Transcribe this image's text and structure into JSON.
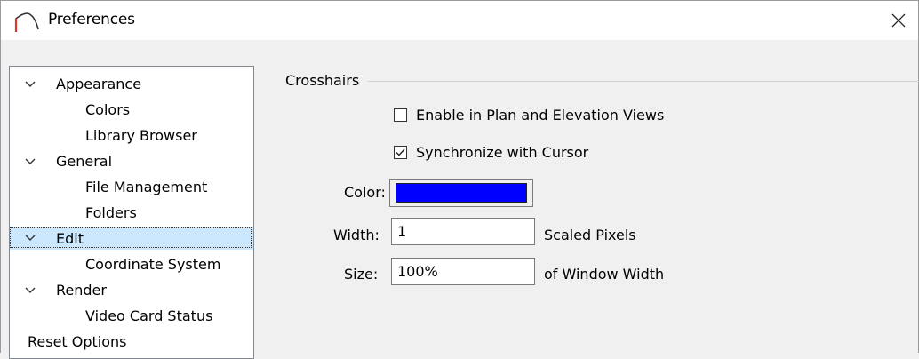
{
  "window": {
    "title": "Preferences"
  },
  "tree": {
    "items": [
      {
        "label": "Appearance",
        "expandable": true
      },
      {
        "label": "Colors",
        "expandable": false
      },
      {
        "label": "Library Browser",
        "expandable": false
      },
      {
        "label": "General",
        "expandable": true
      },
      {
        "label": "File Management",
        "expandable": false
      },
      {
        "label": "Folders",
        "expandable": false
      },
      {
        "label": "Edit",
        "expandable": true,
        "selected": true
      },
      {
        "label": "Coordinate System",
        "expandable": false
      },
      {
        "label": "Render",
        "expandable": true
      },
      {
        "label": "Video Card Status",
        "expandable": false
      },
      {
        "label": "Reset Options",
        "expandable": false
      }
    ]
  },
  "crosshairs": {
    "group_label": "Crosshairs",
    "enable_label": "Enable in Plan and Elevation Views",
    "enable_checked": false,
    "sync_label": "Synchronize with Cursor",
    "sync_checked": true,
    "color_label": "Color:",
    "color_value": "#0000ff",
    "width_label": "Width:",
    "width_value": "1",
    "width_unit": "Scaled Pixels",
    "size_label": "Size:",
    "size_value": "100%",
    "size_unit": "of Window Width"
  },
  "colors": {
    "app_icon": "#d9382c",
    "selection": "#cce8ff"
  }
}
